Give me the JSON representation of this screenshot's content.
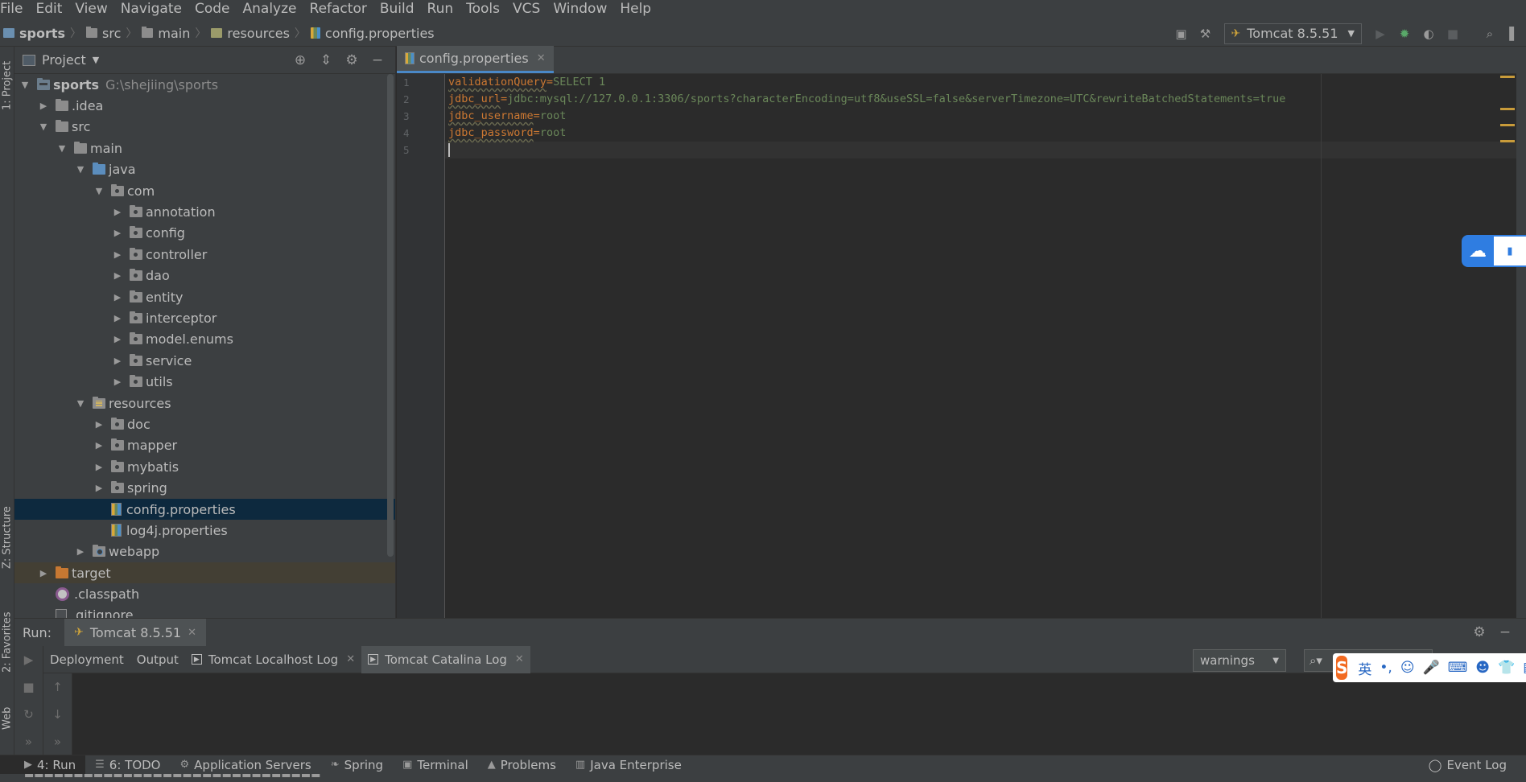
{
  "menu": [
    "File",
    "Edit",
    "View",
    "Navigate",
    "Code",
    "Analyze",
    "Refactor",
    "Build",
    "Run",
    "Tools",
    "VCS",
    "Window",
    "Help"
  ],
  "breadcrumb": [
    "sports",
    "src",
    "main",
    "resources",
    "config.properties"
  ],
  "toolbar": {
    "run_config": "Tomcat 8.5.51"
  },
  "left_stripe": {
    "project_tab": "1: Project",
    "structure_tab": "Z: Structure",
    "favorites_tab": "2: Favorites",
    "web_tab": "Web"
  },
  "project_panel": {
    "title": "Project",
    "tree": [
      {
        "label": "sports",
        "path": "G:\\shejiing\\sports",
        "depth": 0,
        "expanded": true,
        "icon": "project-folder-icon"
      },
      {
        "label": ".idea",
        "depth": 1,
        "expanded": false,
        "icon": "folder-icon"
      },
      {
        "label": "src",
        "depth": 1,
        "expanded": true,
        "icon": "folder-icon"
      },
      {
        "label": "main",
        "depth": 2,
        "expanded": true,
        "icon": "folder-icon"
      },
      {
        "label": "java",
        "depth": 3,
        "expanded": true,
        "icon": "source-folder-icon"
      },
      {
        "label": "com",
        "depth": 4,
        "expanded": true,
        "icon": "package-icon"
      },
      {
        "label": "annotation",
        "depth": 5,
        "expanded": false,
        "icon": "package-icon"
      },
      {
        "label": "config",
        "depth": 5,
        "expanded": false,
        "icon": "package-icon"
      },
      {
        "label": "controller",
        "depth": 5,
        "expanded": false,
        "icon": "package-icon"
      },
      {
        "label": "dao",
        "depth": 5,
        "expanded": false,
        "icon": "package-icon"
      },
      {
        "label": "entity",
        "depth": 5,
        "expanded": false,
        "icon": "package-icon"
      },
      {
        "label": "interceptor",
        "depth": 5,
        "expanded": false,
        "icon": "package-icon"
      },
      {
        "label": "model.enums",
        "depth": 5,
        "expanded": false,
        "icon": "package-icon"
      },
      {
        "label": "service",
        "depth": 5,
        "expanded": false,
        "icon": "package-icon"
      },
      {
        "label": "utils",
        "depth": 5,
        "expanded": false,
        "icon": "package-icon"
      },
      {
        "label": "resources",
        "depth": 3,
        "expanded": true,
        "icon": "resources-folder-icon"
      },
      {
        "label": "doc",
        "depth": 4,
        "expanded": false,
        "icon": "package-icon"
      },
      {
        "label": "mapper",
        "depth": 4,
        "expanded": false,
        "icon": "package-icon"
      },
      {
        "label": "mybatis",
        "depth": 4,
        "expanded": false,
        "icon": "package-icon"
      },
      {
        "label": "spring",
        "depth": 4,
        "expanded": false,
        "icon": "package-icon"
      },
      {
        "label": "config.properties",
        "depth": 4,
        "leaf": true,
        "selected": true,
        "icon": "properties-file-icon"
      },
      {
        "label": "log4j.properties",
        "depth": 4,
        "leaf": true,
        "icon": "properties-file-icon"
      },
      {
        "label": "webapp",
        "depth": 3,
        "expanded": false,
        "icon": "web-folder-icon"
      },
      {
        "label": "target",
        "depth": 1,
        "expanded": false,
        "icon": "excluded-folder-icon",
        "highlight": true
      },
      {
        "label": ".classpath",
        "depth": 1,
        "leaf": true,
        "icon": "classpath-file-icon"
      },
      {
        "label": ".gitignore",
        "depth": 1,
        "leaf": true,
        "icon": "gitignore-file-icon"
      }
    ]
  },
  "editor": {
    "tab_label": "config.properties",
    "lines": [
      {
        "num": "1",
        "key": "validationQuery",
        "value": "SELECT 1"
      },
      {
        "num": "2",
        "key": "jdbc_url",
        "value": "jdbc:mysql://127.0.0.1:3306/sports?characterEncoding=utf8&useSSL=false&serverTimezone=UTC&rewriteBatchedStatements=true"
      },
      {
        "num": "3",
        "key": "jdbc_username",
        "value": "root"
      },
      {
        "num": "4",
        "key": "jdbc_password",
        "value": "root"
      },
      {
        "num": "5",
        "key": "",
        "value": ""
      }
    ]
  },
  "run_panel": {
    "label": "Run:",
    "config_tab": "Tomcat 8.5.51",
    "log_tabs": [
      "Deployment",
      "Output",
      "Tomcat Localhost Log",
      "Tomcat Catalina Log"
    ],
    "filter_value": "warnings"
  },
  "ime": {
    "logo": "S",
    "mode": "英",
    "punct": "•,"
  },
  "bottom_tabs": [
    {
      "label": "4: Run",
      "icon": "run-icon"
    },
    {
      "label": "6: TODO",
      "icon": "todo-icon"
    },
    {
      "label": "Application Servers",
      "icon": "server-icon"
    },
    {
      "label": "Spring",
      "icon": "spring-icon"
    },
    {
      "label": "Terminal",
      "icon": "terminal-icon"
    },
    {
      "label": "Problems",
      "icon": "warning-icon"
    },
    {
      "label": "Java Enterprise",
      "icon": "java-enterprise-icon"
    }
  ],
  "event_log": "Event Log",
  "colors": {
    "background": "#2b2b2b",
    "panel": "#3c3f41",
    "selection": "#0d293e",
    "key": "#cc7832",
    "value": "#6a8759",
    "accent": "#4a88c7"
  }
}
